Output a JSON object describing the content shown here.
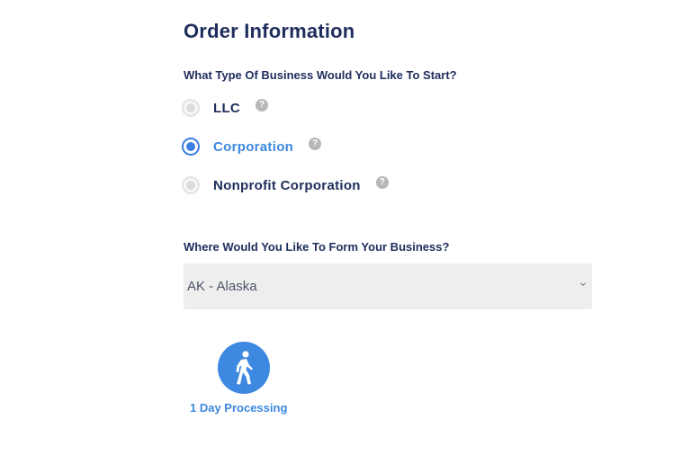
{
  "form": {
    "title": "Order Information",
    "business_type_question": "What Type Of Business Would You Like To Start?",
    "business_types": [
      {
        "label": "LLC",
        "selected": false
      },
      {
        "label": "Corporation",
        "selected": true
      },
      {
        "label": "Nonprofit Corporation",
        "selected": false
      }
    ],
    "help_glyph": "?",
    "state_question": "Where Would You Like To Form Your Business?",
    "state_select": {
      "value": "AK - Alaska"
    },
    "processing": {
      "icon": "walking-person-icon",
      "label": "1 Day Processing"
    }
  },
  "colors": {
    "navy": "#1f2d5c",
    "accent": "#3d88e0",
    "help_badge": "#b7b7b7",
    "select_bg": "#eeeeee"
  }
}
